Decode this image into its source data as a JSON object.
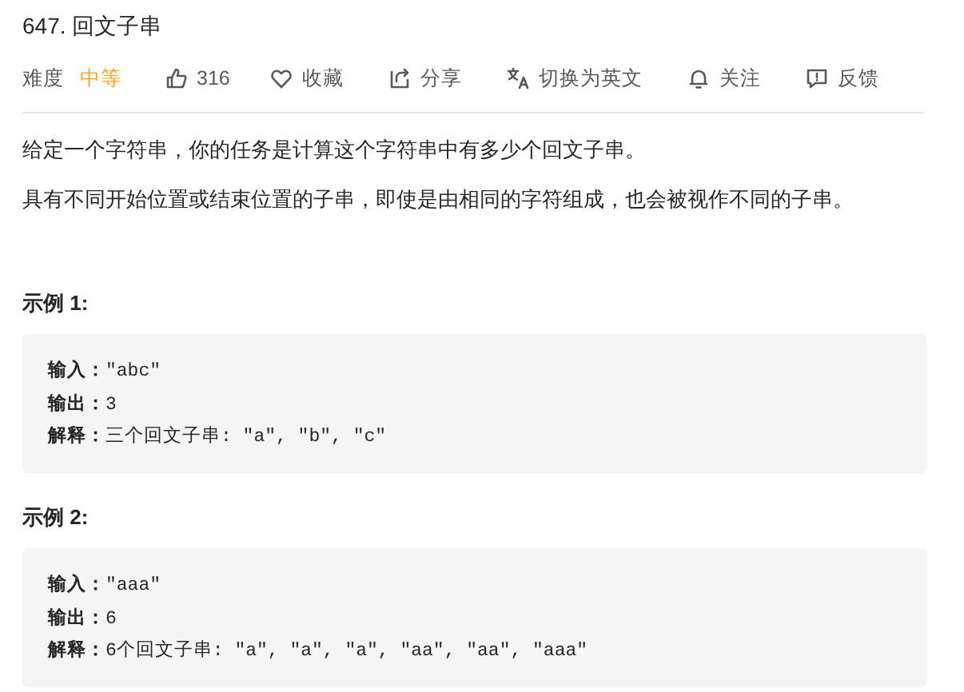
{
  "title": "647. 回文子串",
  "meta": {
    "difficulty_label": "难度",
    "difficulty": "中等"
  },
  "actions": [
    {
      "kind": "like",
      "label": "316"
    },
    {
      "kind": "favorite",
      "label": "收藏"
    },
    {
      "kind": "share",
      "label": "分享"
    },
    {
      "kind": "translate",
      "label": "切换为英文"
    },
    {
      "kind": "bell",
      "label": "关注"
    },
    {
      "kind": "feedback",
      "label": "反馈"
    }
  ],
  "paragraphs": [
    "给定一个字符串，你的任务是计算这个字符串中有多少个回文子串。",
    "具有不同开始位置或结束位置的子串，即使是由相同的字符组成，也会被视作不同的子串。"
  ],
  "examples": [
    {
      "title": "示例 1:",
      "lines": [
        {
          "label": "输入：",
          "value": "\"abc\""
        },
        {
          "label": "输出：",
          "value": "3"
        },
        {
          "label": "解释：",
          "value": "三个回文子串: \"a\", \"b\", \"c\""
        }
      ]
    },
    {
      "title": "示例 2:",
      "lines": [
        {
          "label": "输入：",
          "value": "\"aaa\""
        },
        {
          "label": "输出：",
          "value": "6"
        },
        {
          "label": "解释：",
          "value": "6个回文子串: \"a\", \"a\", \"a\", \"aa\", \"aa\", \"aaa\""
        }
      ]
    }
  ]
}
